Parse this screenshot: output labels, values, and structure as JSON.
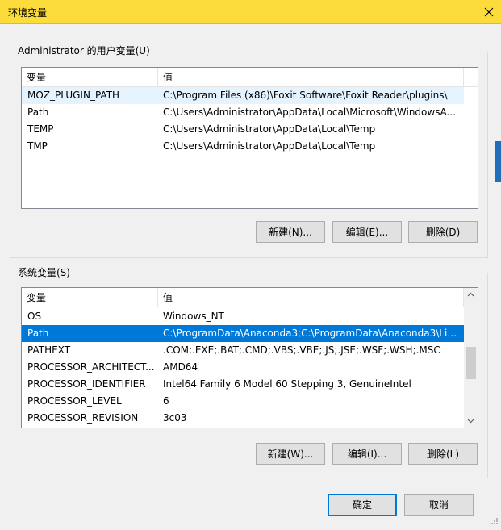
{
  "window": {
    "title": "环境变量",
    "close_glyph": "✕"
  },
  "user_vars": {
    "group_label": "Administrator 的用户变量(U)",
    "col_name": "变量",
    "col_value": "值",
    "rows": [
      {
        "name": "MOZ_PLUGIN_PATH",
        "value": "C:\\Program Files (x86)\\Foxit Software\\Foxit Reader\\plugins\\"
      },
      {
        "name": "Path",
        "value": "C:\\Users\\Administrator\\AppData\\Local\\Microsoft\\WindowsA..."
      },
      {
        "name": "TEMP",
        "value": "C:\\Users\\Administrator\\AppData\\Local\\Temp"
      },
      {
        "name": "TMP",
        "value": "C:\\Users\\Administrator\\AppData\\Local\\Temp"
      }
    ],
    "buttons": {
      "new": "新建(N)...",
      "edit": "编辑(E)...",
      "delete": "删除(D)"
    }
  },
  "system_vars": {
    "group_label": "系统变量(S)",
    "col_name": "变量",
    "col_value": "值",
    "rows": [
      {
        "name": "OS",
        "value": "Windows_NT"
      },
      {
        "name": "Path",
        "value": "C:\\ProgramData\\Anaconda3;C:\\ProgramData\\Anaconda3\\Lib..."
      },
      {
        "name": "PATHEXT",
        "value": ".COM;.EXE;.BAT;.CMD;.VBS;.VBE;.JS;.JSE;.WSF;.WSH;.MSC"
      },
      {
        "name": "PROCESSOR_ARCHITECT...",
        "value": "AMD64"
      },
      {
        "name": "PROCESSOR_IDENTIFIER",
        "value": "Intel64 Family 6 Model 60 Stepping 3, GenuineIntel"
      },
      {
        "name": "PROCESSOR_LEVEL",
        "value": "6"
      },
      {
        "name": "PROCESSOR_REVISION",
        "value": "3c03"
      }
    ],
    "selected_row": "Path",
    "buttons": {
      "new": "新建(W)...",
      "edit": "编辑(I)...",
      "delete": "删除(L)"
    }
  },
  "dialog_buttons": {
    "ok": "确定",
    "cancel": "取消"
  },
  "colors": {
    "titlebar": "#fbdc3a",
    "selection": "#0078d7",
    "hover": "#e5f3ff",
    "default_button_border": "#0078d7"
  }
}
